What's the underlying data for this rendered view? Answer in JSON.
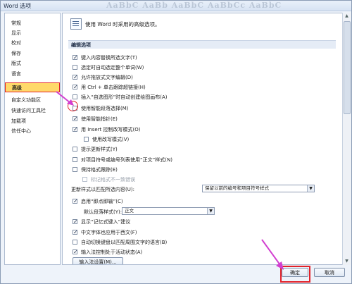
{
  "window": {
    "title": "Word 选项"
  },
  "ribbon_ghost": "AaBbC AaBb AaBbC AaBbCc AaBbC",
  "nav": {
    "items": [
      {
        "label": "常规"
      },
      {
        "label": "显示"
      },
      {
        "label": "校对"
      },
      {
        "label": "保存"
      },
      {
        "label": "版式"
      },
      {
        "label": "语言"
      },
      {
        "label": "高级",
        "active": true
      },
      {
        "label": "自定义功能区"
      },
      {
        "label": "快速访问工具栏"
      },
      {
        "label": "加载项"
      },
      {
        "label": "信任中心"
      }
    ]
  },
  "content": {
    "header": "使用 Word 时采用的高级选项。",
    "section_title": "编辑选项",
    "options": [
      {
        "label": "键入内容替换所选文字(T)",
        "checked": true
      },
      {
        "label": "选定时自动选定整个单词(W)",
        "checked": false
      },
      {
        "label": "允许拖放式文字编辑(D)",
        "checked": true
      },
      {
        "label": "用 Ctrl + 单击跟踪超链接(H)",
        "checked": true
      },
      {
        "label": "插入“自选图形”时自动创建绘图画布(A)",
        "checked": false
      },
      {
        "label": "使用智能段落选择(M)",
        "checked": false
      },
      {
        "label": "使用智能指针(E)",
        "checked": true
      },
      {
        "label": "用 Insert 控制改写模式(O)",
        "checked": true
      },
      {
        "label": "使用改写模式(V)",
        "checked": false
      },
      {
        "label": "提示更新样式(Y)",
        "checked": false
      },
      {
        "label": "对项目符号或编号列表使用“正文”样式(N)",
        "checked": false
      },
      {
        "label": "保持格式跟踪(E)",
        "checked": false
      },
      {
        "label": "标记格式不一致错误",
        "checked": false,
        "disabled": true
      }
    ],
    "update_style_label": "更新样式以匹配所选内容(U):",
    "update_style_value": "保留以前的编号和项目符号样式",
    "click_and_type": {
      "label": "启用“即点即输”(C)",
      "checked": true
    },
    "default_para_style_label": "默认段落样式(Y):",
    "default_para_style_value": "正文",
    "options2": [
      {
        "label": "显示“记忆式键入”建议",
        "checked": true
      },
      {
        "label": "中文字体也应用于西文(F)",
        "checked": true
      },
      {
        "label": "自动切换键盘以匹配周围文字的语言(B)",
        "checked": false
      },
      {
        "label": "输入法控制处于活动状态(A)",
        "checked": true
      }
    ],
    "ime_button": "输入法设置(M)..."
  },
  "footer": {
    "ok": "确定",
    "cancel": "取消"
  },
  "annotation_color": "#e2222a",
  "arrow_color": "#d23fd0"
}
